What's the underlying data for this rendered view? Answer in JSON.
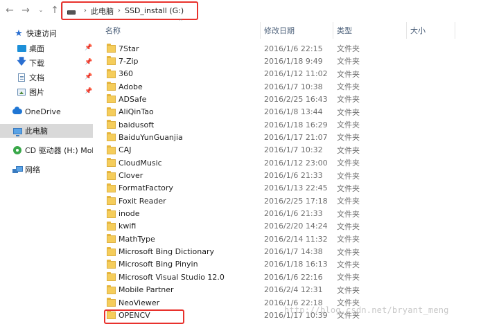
{
  "nav": {
    "back_icon": "arrow-left-icon",
    "forward_icon": "arrow-right-icon",
    "recent_icon": "chevron-down-icon",
    "up_icon": "arrow-up-icon"
  },
  "address_bar": {
    "drive_icon": "drive-icon",
    "separator": "›",
    "crumbs": [
      "此电脑",
      "SSD_install (G:)"
    ]
  },
  "sidebar": {
    "items": [
      {
        "label": "快速访问",
        "icon": "star-icon"
      },
      {
        "label": "桌面",
        "icon": "desktop-icon",
        "pinned": true
      },
      {
        "label": "下载",
        "icon": "download-icon",
        "pinned": true
      },
      {
        "label": "文档",
        "icon": "document-icon",
        "pinned": true
      },
      {
        "label": "图片",
        "icon": "picture-icon",
        "pinned": true
      },
      {
        "label": "OneDrive",
        "icon": "cloud-icon"
      },
      {
        "label": "此电脑",
        "icon": "computer-icon",
        "selected": true
      },
      {
        "label": "CD 驱动器 (H:) Mob",
        "icon": "cd-drive-icon"
      },
      {
        "label": "网络",
        "icon": "network-icon"
      }
    ]
  },
  "columns": {
    "name": "名称",
    "date": "修改日期",
    "type": "类型",
    "size": "大小"
  },
  "files": [
    {
      "name": "7Star",
      "date": "2016/1/6 22:15",
      "type": "文件夹"
    },
    {
      "name": "7-Zip",
      "date": "2016/1/18 9:49",
      "type": "文件夹"
    },
    {
      "name": "360",
      "date": "2016/1/12 11:02",
      "type": "文件夹"
    },
    {
      "name": "Adobe",
      "date": "2016/1/7 10:38",
      "type": "文件夹"
    },
    {
      "name": "ADSafe",
      "date": "2016/2/25 16:43",
      "type": "文件夹"
    },
    {
      "name": "AliQinTao",
      "date": "2016/1/8 13:44",
      "type": "文件夹"
    },
    {
      "name": "baidusoft",
      "date": "2016/1/18 16:29",
      "type": "文件夹"
    },
    {
      "name": "BaiduYunGuanjia",
      "date": "2016/1/17 21:07",
      "type": "文件夹"
    },
    {
      "name": "CAJ",
      "date": "2016/1/7 10:32",
      "type": "文件夹"
    },
    {
      "name": "CloudMusic",
      "date": "2016/1/12 23:00",
      "type": "文件夹"
    },
    {
      "name": "Clover",
      "date": "2016/1/6 21:33",
      "type": "文件夹"
    },
    {
      "name": "FormatFactory",
      "date": "2016/1/13 22:45",
      "type": "文件夹"
    },
    {
      "name": "Foxit Reader",
      "date": "2016/2/25 17:18",
      "type": "文件夹"
    },
    {
      "name": "inode",
      "date": "2016/1/6 21:33",
      "type": "文件夹"
    },
    {
      "name": "kwifi",
      "date": "2016/2/20 14:24",
      "type": "文件夹"
    },
    {
      "name": "MathType",
      "date": "2016/2/14 11:32",
      "type": "文件夹"
    },
    {
      "name": "Microsoft Bing Dictionary",
      "date": "2016/1/7 14:38",
      "type": "文件夹"
    },
    {
      "name": "Microsoft Bing Pinyin",
      "date": "2016/1/18 16:13",
      "type": "文件夹"
    },
    {
      "name": "Microsoft Visual Studio 12.0",
      "date": "2016/1/6 22:16",
      "type": "文件夹"
    },
    {
      "name": "Mobile Partner",
      "date": "2016/2/4 12:31",
      "type": "文件夹"
    },
    {
      "name": "NeoViewer",
      "date": "2016/1/6 22:18",
      "type": "文件夹"
    },
    {
      "name": "OPENCV",
      "date": "2016/1/17 10:39",
      "type": "文件夹"
    }
  ],
  "watermark": "http://blog.csdn.net/bryant_meng",
  "colors": {
    "highlight_red": "#e8312c",
    "folder_yellow": "#f5cd5b",
    "selected_bg": "#d9d9d9"
  }
}
